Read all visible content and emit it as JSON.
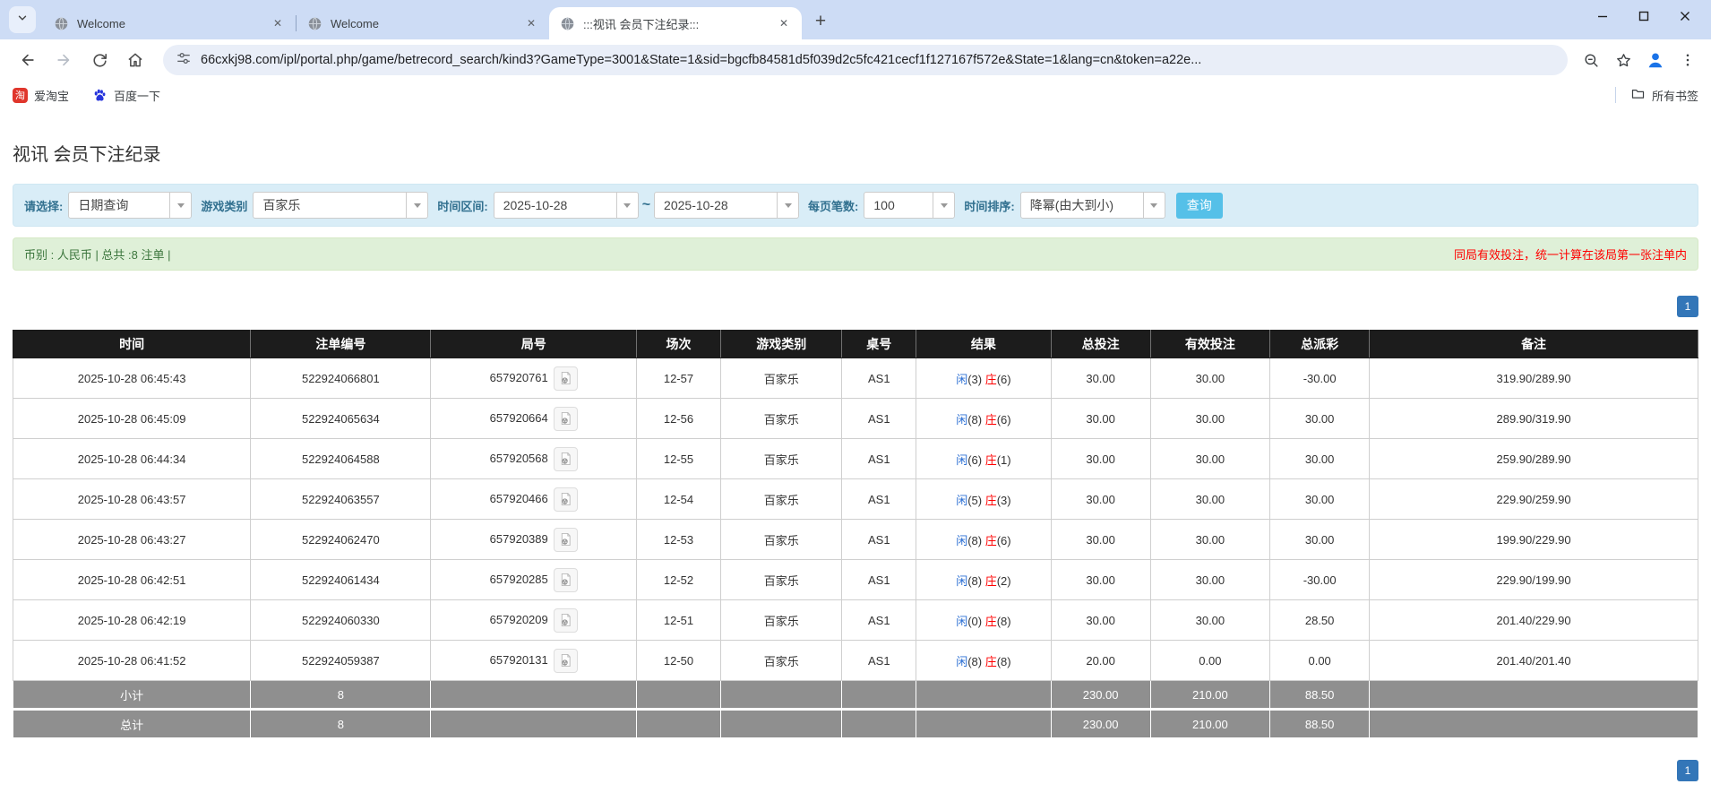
{
  "icons": {
    "close": "✕",
    "plus": "+",
    "tilde": "~"
  },
  "browser": {
    "tabs": [
      {
        "label": "Welcome"
      },
      {
        "label": "Welcome"
      },
      {
        "label": ":::视讯 会员下注纪录:::"
      }
    ],
    "url": "66cxkj98.com/ipl/portal.php/game/betrecord_search/kind3?GameType=3001&State=1&sid=bgcfb84581d5f039d2c5fc421cecf1f127167f572e&State=1&lang=cn&token=a22e...",
    "bookmarks": [
      {
        "label": "爱淘宝"
      },
      {
        "label": "百度一下"
      }
    ],
    "bookmarks_right": "所有书签"
  },
  "page": {
    "title": "视讯 会员下注纪录",
    "filters": {
      "select_label": "请选择:",
      "select_value": "日期查询",
      "game_type_label": "游戏类别",
      "game_type_value": "百家乐",
      "date_range_label": "时间区间:",
      "date_from": "2025-10-28",
      "date_to": "2025-10-28",
      "page_size_label": "每页笔数:",
      "page_size_value": "100",
      "sort_label": "时间排序:",
      "sort_value": "降幂(由大到小)",
      "search_button": "查询"
    },
    "summary": {
      "left": "币别 : 人民币 | 总共 :8 注单 |",
      "right": "同局有效投注，统一计算在该局第一张注单内"
    },
    "pagination": "1",
    "colors": {
      "accent_blue": "#2b6fd4",
      "negative_red": "#ff0000",
      "header_black": "#1c1c1c"
    },
    "table": {
      "headers": [
        "时间",
        "注单编号",
        "局号",
        "场次",
        "游戏类别",
        "桌号",
        "结果",
        "总投注",
        "有效投注",
        "总派彩",
        "备注"
      ],
      "rows": [
        {
          "time": "2025-10-28 06:45:43",
          "bet_id": "522924066801",
          "round": "657920761",
          "session": "12-57",
          "game": "百家乐",
          "table_no": "AS1",
          "result": {
            "player": "闲",
            "player_n": "(3)",
            "banker": "庄",
            "banker_n": "(6)"
          },
          "total_bet": "30.00",
          "valid_bet": "30.00",
          "payout": "-30.00",
          "remark": "319.90/289.90"
        },
        {
          "time": "2025-10-28 06:45:09",
          "bet_id": "522924065634",
          "round": "657920664",
          "session": "12-56",
          "game": "百家乐",
          "table_no": "AS1",
          "result": {
            "player": "闲",
            "player_n": "(8)",
            "banker": "庄",
            "banker_n": "(6)"
          },
          "total_bet": "30.00",
          "valid_bet": "30.00",
          "payout": "30.00",
          "remark": "289.90/319.90"
        },
        {
          "time": "2025-10-28 06:44:34",
          "bet_id": "522924064588",
          "round": "657920568",
          "session": "12-55",
          "game": "百家乐",
          "table_no": "AS1",
          "result": {
            "player": "闲",
            "player_n": "(6)",
            "banker": "庄",
            "banker_n": "(1)"
          },
          "total_bet": "30.00",
          "valid_bet": "30.00",
          "payout": "30.00",
          "remark": "259.90/289.90"
        },
        {
          "time": "2025-10-28 06:43:57",
          "bet_id": "522924063557",
          "round": "657920466",
          "session": "12-54",
          "game": "百家乐",
          "table_no": "AS1",
          "result": {
            "player": "闲",
            "player_n": "(5)",
            "banker": "庄",
            "banker_n": "(3)"
          },
          "total_bet": "30.00",
          "valid_bet": "30.00",
          "payout": "30.00",
          "remark": "229.90/259.90"
        },
        {
          "time": "2025-10-28 06:43:27",
          "bet_id": "522924062470",
          "round": "657920389",
          "session": "12-53",
          "game": "百家乐",
          "table_no": "AS1",
          "result": {
            "player": "闲",
            "player_n": "(8)",
            "banker": "庄",
            "banker_n": "(6)"
          },
          "total_bet": "30.00",
          "valid_bet": "30.00",
          "payout": "30.00",
          "remark": "199.90/229.90"
        },
        {
          "time": "2025-10-28 06:42:51",
          "bet_id": "522924061434",
          "round": "657920285",
          "session": "12-52",
          "game": "百家乐",
          "table_no": "AS1",
          "result": {
            "player": "闲",
            "player_n": "(8)",
            "banker": "庄",
            "banker_n": "(2)"
          },
          "total_bet": "30.00",
          "valid_bet": "30.00",
          "payout": "-30.00",
          "remark": "229.90/199.90"
        },
        {
          "time": "2025-10-28 06:42:19",
          "bet_id": "522924060330",
          "round": "657920209",
          "session": "12-51",
          "game": "百家乐",
          "table_no": "AS1",
          "result": {
            "player": "闲",
            "player_n": "(0)",
            "banker": "庄",
            "banker_n": "(8)"
          },
          "total_bet": "30.00",
          "valid_bet": "30.00",
          "payout": "28.50",
          "remark": "201.40/229.90"
        },
        {
          "time": "2025-10-28 06:41:52",
          "bet_id": "522924059387",
          "round": "657920131",
          "session": "12-50",
          "game": "百家乐",
          "table_no": "AS1",
          "result": {
            "player": "闲",
            "player_n": "(8)",
            "banker": "庄",
            "banker_n": "(8)"
          },
          "total_bet": "20.00",
          "valid_bet": "0.00",
          "payout": "0.00",
          "remark": "201.40/201.40"
        }
      ],
      "subtotal": {
        "label": "小计",
        "count": "8",
        "total_bet": "230.00",
        "valid_bet": "210.00",
        "payout": "88.50"
      },
      "total": {
        "label": "总计",
        "count": "8",
        "total_bet": "230.00",
        "valid_bet": "210.00",
        "payout": "88.50"
      }
    }
  }
}
